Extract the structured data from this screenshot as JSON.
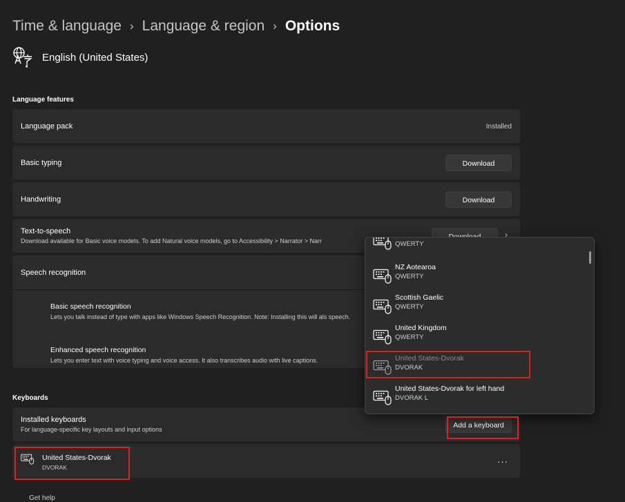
{
  "breadcrumb": [
    "Time & language",
    "Language & region",
    "Options"
  ],
  "language": {
    "name": "English (United States)",
    "icon": "language-icon"
  },
  "language_features": {
    "heading": "Language features",
    "language_pack": {
      "label": "Language pack",
      "status": "Installed"
    },
    "basic_typing": {
      "label": "Basic typing",
      "button": "Download"
    },
    "handwriting": {
      "label": "Handwriting",
      "button": "Download"
    },
    "tts": {
      "label": "Text-to-speech",
      "desc": "Download available for Basic voice models. To add Natural voice models, go to Accessibility > Narrator > Narr",
      "button": "Download"
    },
    "speech": {
      "label": "Speech recognition",
      "basic": {
        "title": "Basic speech recognition",
        "desc": "Lets you talk instead of type with apps like Windows Speech Recognition. Note: Installing this will als speech."
      },
      "enhanced": {
        "title": "Enhanced speech recognition",
        "desc": "Lets you enter text with voice typing and voice access. It also transcribes audio with live captions."
      }
    }
  },
  "keyboards": {
    "heading": "Keyboards",
    "installed": {
      "label": "Installed keyboards",
      "desc": "For language-specific key layouts and input options",
      "button": "Add a keyboard"
    },
    "item": {
      "name": "United States-Dvorak",
      "layout": "DVORAK",
      "menu": "···"
    }
  },
  "popup": {
    "items": [
      {
        "name": "",
        "layout": "QWERTY"
      },
      {
        "name": "NZ Aotearoa",
        "layout": "QWERTY"
      },
      {
        "name": "Scottish Gaelic",
        "layout": "QWERTY"
      },
      {
        "name": "United Kingdom",
        "layout": "QWERTY"
      },
      {
        "name": "United States-Dvorak",
        "layout": "DVORAK",
        "disabled": true
      },
      {
        "name": "United States-Dvorak for left hand",
        "layout": "DVORAK L"
      }
    ]
  },
  "footer": {
    "help": "Get help"
  },
  "colors": {
    "background": "#202020",
    "card": "#2b2b2b",
    "highlight": "#e0201b"
  }
}
